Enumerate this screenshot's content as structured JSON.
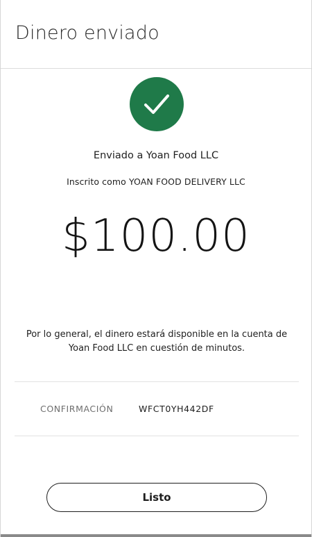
{
  "header": {
    "title": "Dinero enviado"
  },
  "status": {
    "icon": "checkmark-icon",
    "accent_color": "#1f7a49"
  },
  "recipient": {
    "sent_to": "Enviado a Yoan Food LLC",
    "registered_as": "Inscrito como YOAN FOOD DELIVERY LLC"
  },
  "payment": {
    "amount": "$100.00"
  },
  "info": {
    "note": "Por lo general, el dinero estará disponible en la cuenta de Yoan Food LLC en cuestión de minutos."
  },
  "confirmation": {
    "label": "CONFIRMACIÓN",
    "code": "WFCT0YH442DF"
  },
  "actions": {
    "done_label": "Listo"
  }
}
